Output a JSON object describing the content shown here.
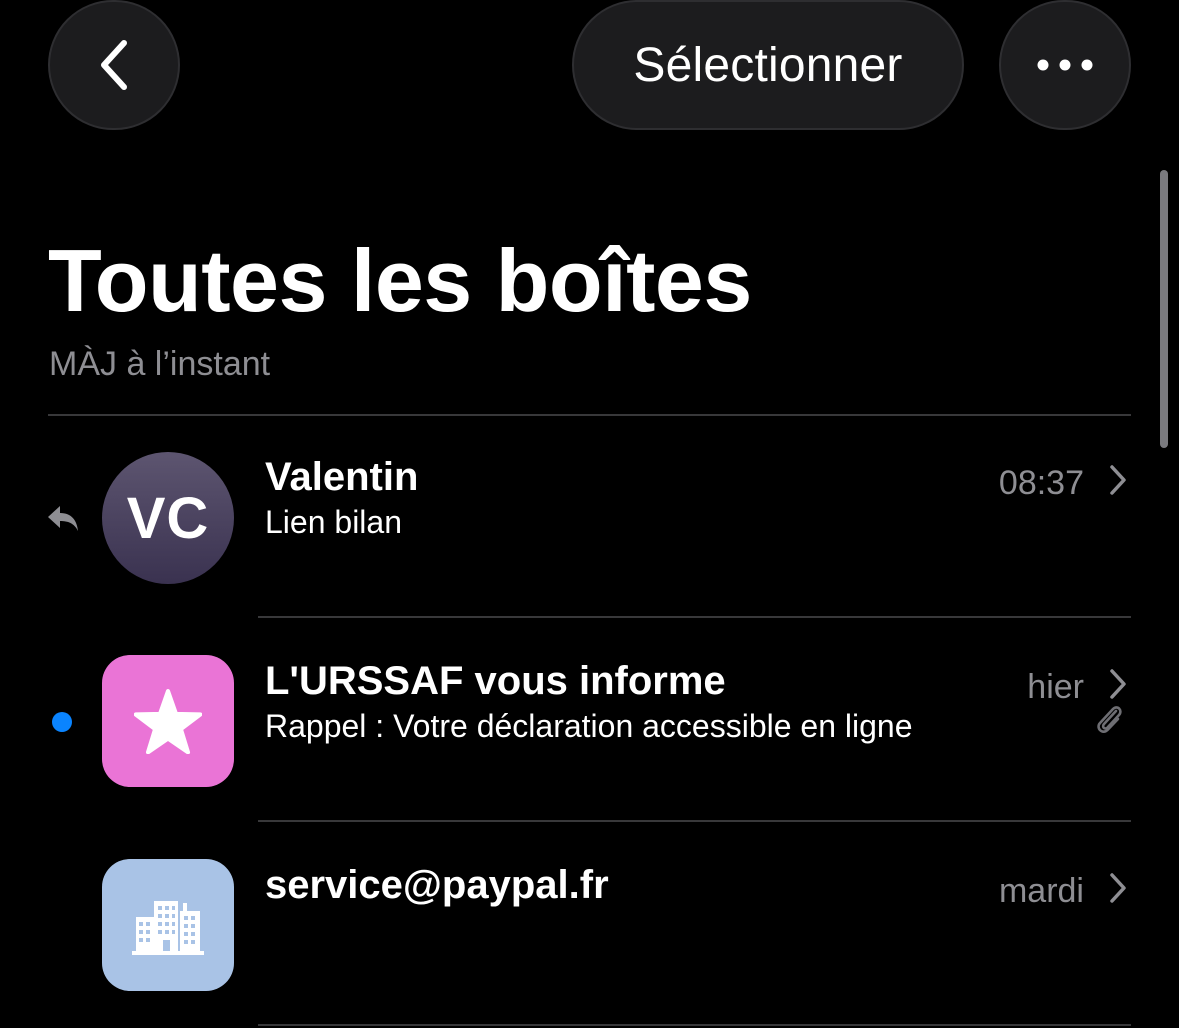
{
  "toolbar": {
    "back_icon": "chevron-left-icon",
    "select_label": "Sélectionner",
    "more_icon": "ellipsis-icon"
  },
  "header": {
    "title": "Toutes les boîtes",
    "status": "MÀJ à l’instant"
  },
  "colors": {
    "background": "#000000",
    "button_bg": "#1c1c1e",
    "secondary_text": "#8e8e93",
    "separator": "#38383a",
    "unread_dot": "#0a84ff",
    "avatar_star_bg": "#ea74d6",
    "avatar_building_bg": "#a9c3e6"
  },
  "messages": [
    {
      "sender": "Valentin",
      "preview": "Lien bilan",
      "time": "08:37",
      "avatar_initials": "VC",
      "replied": true,
      "unread": false,
      "attachment": false
    },
    {
      "sender": "L'URSSAF vous informe",
      "preview": "Rappel : Votre déclaration accessible en ligne",
      "time": "hier",
      "avatar_icon": "star-icon",
      "replied": false,
      "unread": true,
      "attachment": true
    },
    {
      "sender": "service@paypal.fr",
      "preview": "",
      "time": "mardi",
      "avatar_icon": "building-icon",
      "replied": false,
      "unread": false,
      "attachment": false
    }
  ]
}
